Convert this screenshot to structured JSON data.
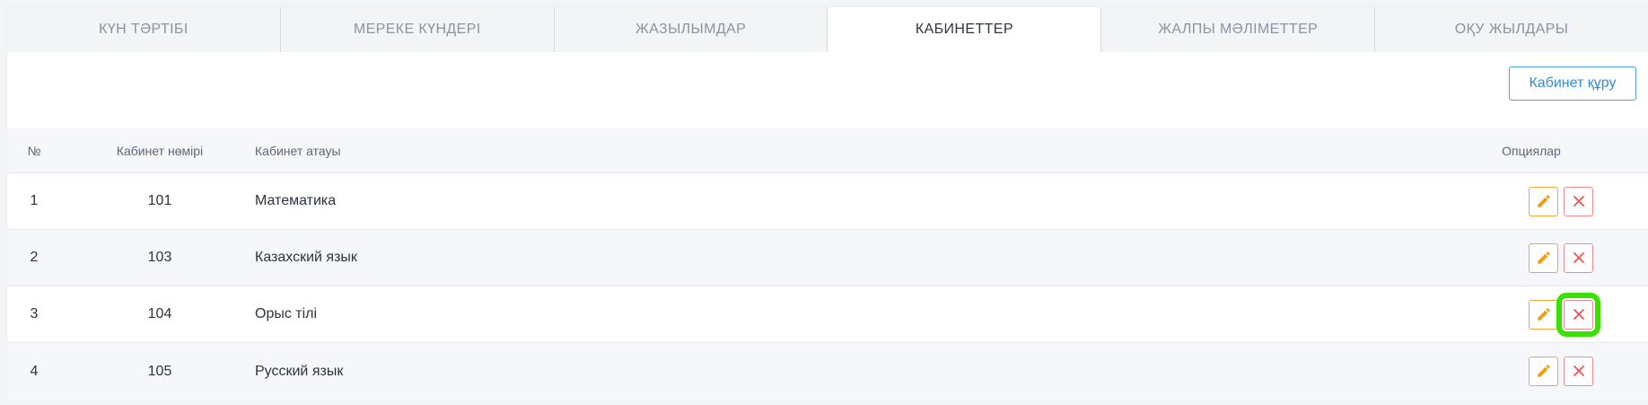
{
  "tabs": [
    {
      "label": "КҮН ТӘРТІБІ",
      "active": false
    },
    {
      "label": "МЕРЕКЕ КҮНДЕРІ",
      "active": false
    },
    {
      "label": "ЖАЗЫЛЫМДАР",
      "active": false
    },
    {
      "label": "КАБИНЕТТЕР",
      "active": true
    },
    {
      "label": "ЖАЛПЫ МӘЛІМЕТТЕР",
      "active": false
    },
    {
      "label": "ОҚУ ЖЫЛДАРЫ",
      "active": false
    }
  ],
  "toolbar": {
    "create_label": "Кабинет құру"
  },
  "table": {
    "headers": {
      "no": "№",
      "room_number": "Кабинет нөмірі",
      "room_name": "Кабинет атауы",
      "options": "Опциялар"
    },
    "rows": [
      {
        "no": "1",
        "room_number": "101",
        "room_name": "Математика"
      },
      {
        "no": "2",
        "room_number": "103",
        "room_name": "Казахский язык"
      },
      {
        "no": "3",
        "room_number": "104",
        "room_name": "Орыс тілі"
      },
      {
        "no": "4",
        "room_number": "105",
        "room_name": "Русский язык"
      }
    ]
  },
  "icons": {
    "edit": "pencil-icon",
    "delete": "close-icon"
  },
  "colors": {
    "accent_blue": "#2f8ce0",
    "edit_orange": "#f39c12",
    "delete_red": "#ef5350",
    "highlight_green": "#39e100"
  }
}
